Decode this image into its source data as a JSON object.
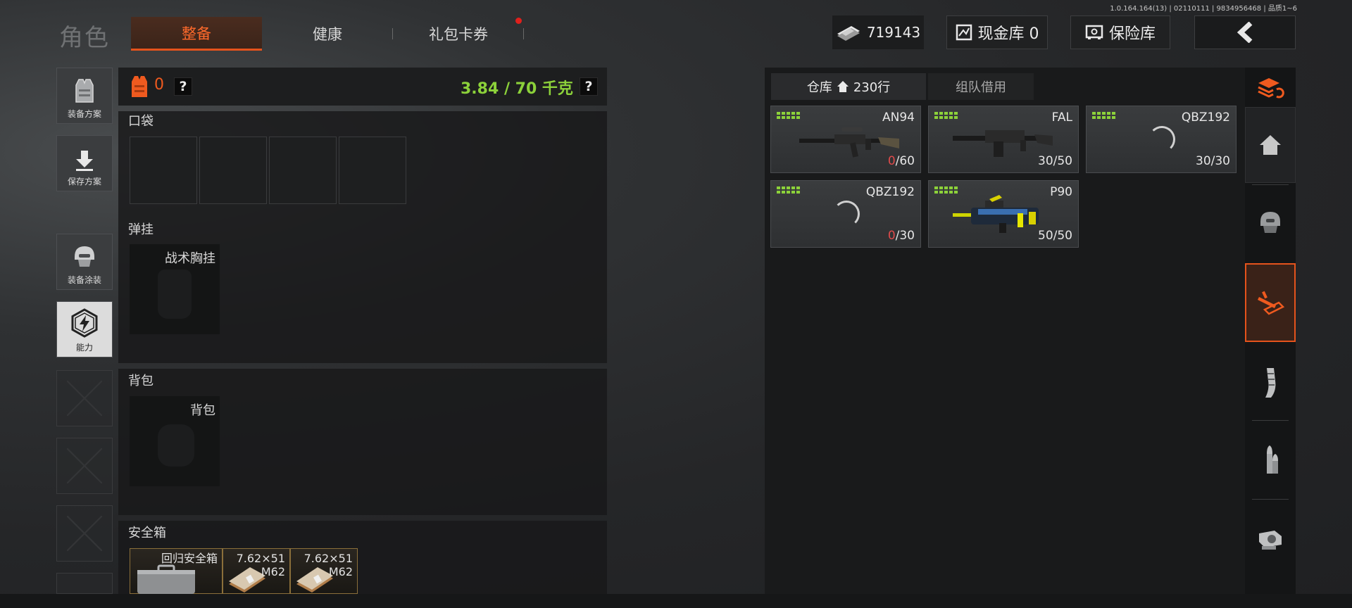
{
  "version_info": "1.0.164.164(13) | 02110111 | 9834956468 | 品质1~6",
  "header": {
    "title": "角色",
    "tabs": [
      {
        "label": "整备",
        "active": true
      },
      {
        "label": "健康",
        "active": false
      },
      {
        "label": "礼包卡券",
        "active": false,
        "has_notification": true
      }
    ],
    "money": "719143",
    "cash_store_label": "现金库 0",
    "safe_store_label": "保险库"
  },
  "sidebar": {
    "items": [
      {
        "label": "装备方案",
        "icon": "vest-icon"
      },
      {
        "label": "保存方案",
        "icon": "download-icon"
      },
      {
        "label": "装备涂装",
        "icon": "helmet-icon"
      },
      {
        "label": "能力",
        "icon": "hexagon-lightning-icon",
        "active": true
      }
    ]
  },
  "loadout": {
    "armor_count": "0",
    "help_label": "?",
    "weight": "3.84 / 70 千克",
    "sections": {
      "pocket": "口袋",
      "chest_rig": "弹挂",
      "backpack": "背包",
      "safe_box": "安全箱"
    },
    "chest_rig_slot": "战术胸挂",
    "backpack_slot": "背包",
    "safe_items": [
      {
        "name": "回归安全箱"
      },
      {
        "line1": "7.62×51",
        "line2": "M62"
      },
      {
        "line1": "7.62×51",
        "line2": "M62"
      }
    ]
  },
  "warehouse": {
    "tabs": [
      {
        "label": "仓库",
        "suffix": "230行",
        "active": true
      },
      {
        "label": "组队借用",
        "active": false
      }
    ],
    "items": [
      {
        "name": "AN94",
        "ammo_current": "0",
        "ammo_max": "/60",
        "empty": true
      },
      {
        "name": "FAL",
        "ammo_current": "30",
        "ammo_max": "/50",
        "empty": false
      },
      {
        "name": "QBZ192",
        "ammo_current": "30",
        "ammo_max": "/30",
        "empty": false,
        "loading": true
      },
      {
        "name": "QBZ192",
        "ammo_current": "0",
        "ammo_max": "/30",
        "empty": true,
        "loading": true
      },
      {
        "name": "P90",
        "ammo_current": "50",
        "ammo_max": "/50",
        "empty": false
      }
    ]
  },
  "category_rail": [
    "sort-icon",
    "home-icon",
    "armor-icon",
    "weapon-icon",
    "magazine-icon",
    "ammo-icon",
    "sight-icon"
  ],
  "colors": {
    "accent": "#e5531c",
    "weight_green": "#8cd13a",
    "grade_green": "#8cd13a",
    "empty_red": "#e04a4a"
  }
}
